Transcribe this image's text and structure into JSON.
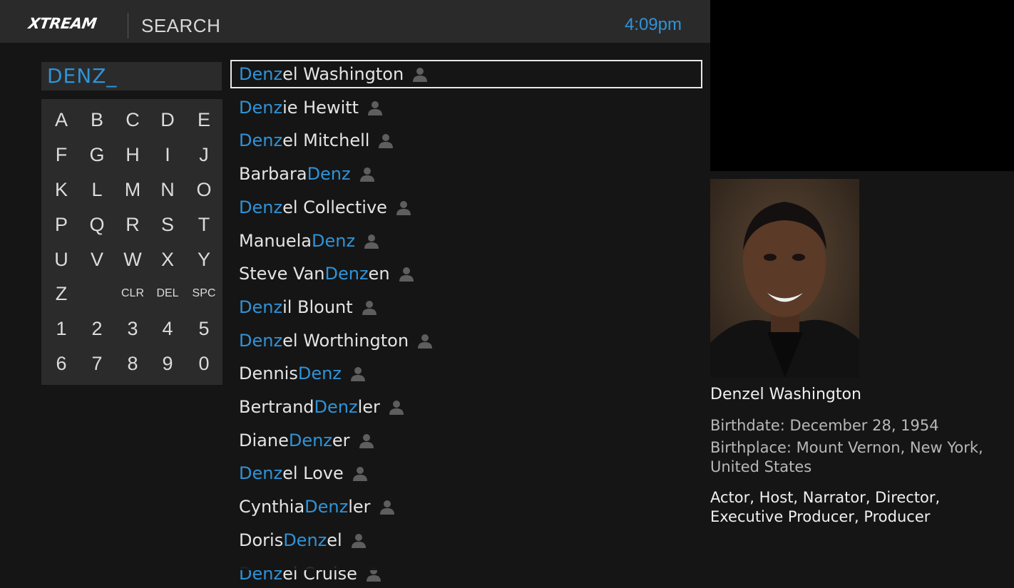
{
  "header": {
    "logo": "XTREAM",
    "title": "SEARCH",
    "clock": "4:09pm"
  },
  "search": {
    "query": "DENZ_"
  },
  "keyboard": {
    "keys": [
      "A",
      "B",
      "C",
      "D",
      "E",
      "F",
      "G",
      "H",
      "I",
      "J",
      "K",
      "L",
      "M",
      "N",
      "O",
      "P",
      "Q",
      "R",
      "S",
      "T",
      "U",
      "V",
      "W",
      "X",
      "Y",
      "Z",
      "CLR",
      "DEL",
      "SPC",
      "1",
      "2",
      "3",
      "4",
      "5",
      "6",
      "7",
      "8",
      "9",
      "0"
    ]
  },
  "results": [
    {
      "pre": "",
      "match": "Denz",
      "post": "el Washington",
      "icon": "person-icon"
    },
    {
      "pre": "",
      "match": "Denz",
      "post": "ie Hewitt",
      "icon": "person-icon"
    },
    {
      "pre": "",
      "match": "Denz",
      "post": "el Mitchell",
      "icon": "person-icon"
    },
    {
      "pre": "Barbara ",
      "match": "Denz",
      "post": "",
      "icon": "person-icon"
    },
    {
      "pre": "",
      "match": "Denz",
      "post": "el Collective",
      "icon": "person-icon"
    },
    {
      "pre": "Manuela ",
      "match": "Denz",
      "post": "",
      "icon": "person-icon"
    },
    {
      "pre": "Steve Van ",
      "match": "Denz",
      "post": "en",
      "icon": "person-icon"
    },
    {
      "pre": "",
      "match": "Denz",
      "post": "il Blount",
      "icon": "person-icon"
    },
    {
      "pre": "",
      "match": "Denz",
      "post": "el Worthington",
      "icon": "person-icon"
    },
    {
      "pre": "Dennis ",
      "match": "Denz",
      "post": "",
      "icon": "person-icon"
    },
    {
      "pre": "Bertrand ",
      "match": "Denz",
      "post": "ler",
      "icon": "person-icon"
    },
    {
      "pre": "Diane ",
      "match": "Denz",
      "post": "er",
      "icon": "person-icon"
    },
    {
      "pre": "",
      "match": "Denz",
      "post": "el Love",
      "icon": "person-icon"
    },
    {
      "pre": "Cynthia ",
      "match": "Denz",
      "post": "ler",
      "icon": "person-icon"
    },
    {
      "pre": "Doris ",
      "match": "Denz",
      "post": "el",
      "icon": "person-icon"
    },
    {
      "pre": "",
      "match": "Denz",
      "post": "el Cruise",
      "icon": "person-icon"
    }
  ],
  "details": {
    "name": "Denzel Washington",
    "birthdate": "Birthdate: December 28, 1954",
    "birthplace_1": "Birthplace: Mount Vernon, New York,",
    "birthplace_2": "United States",
    "roles_1": "Actor, Host, Narrator, Director,",
    "roles_2": "Executive Producer, Producer"
  },
  "colors": {
    "accent": "#2f93d8",
    "background": "#151515",
    "panel": "#2b2b2b"
  }
}
